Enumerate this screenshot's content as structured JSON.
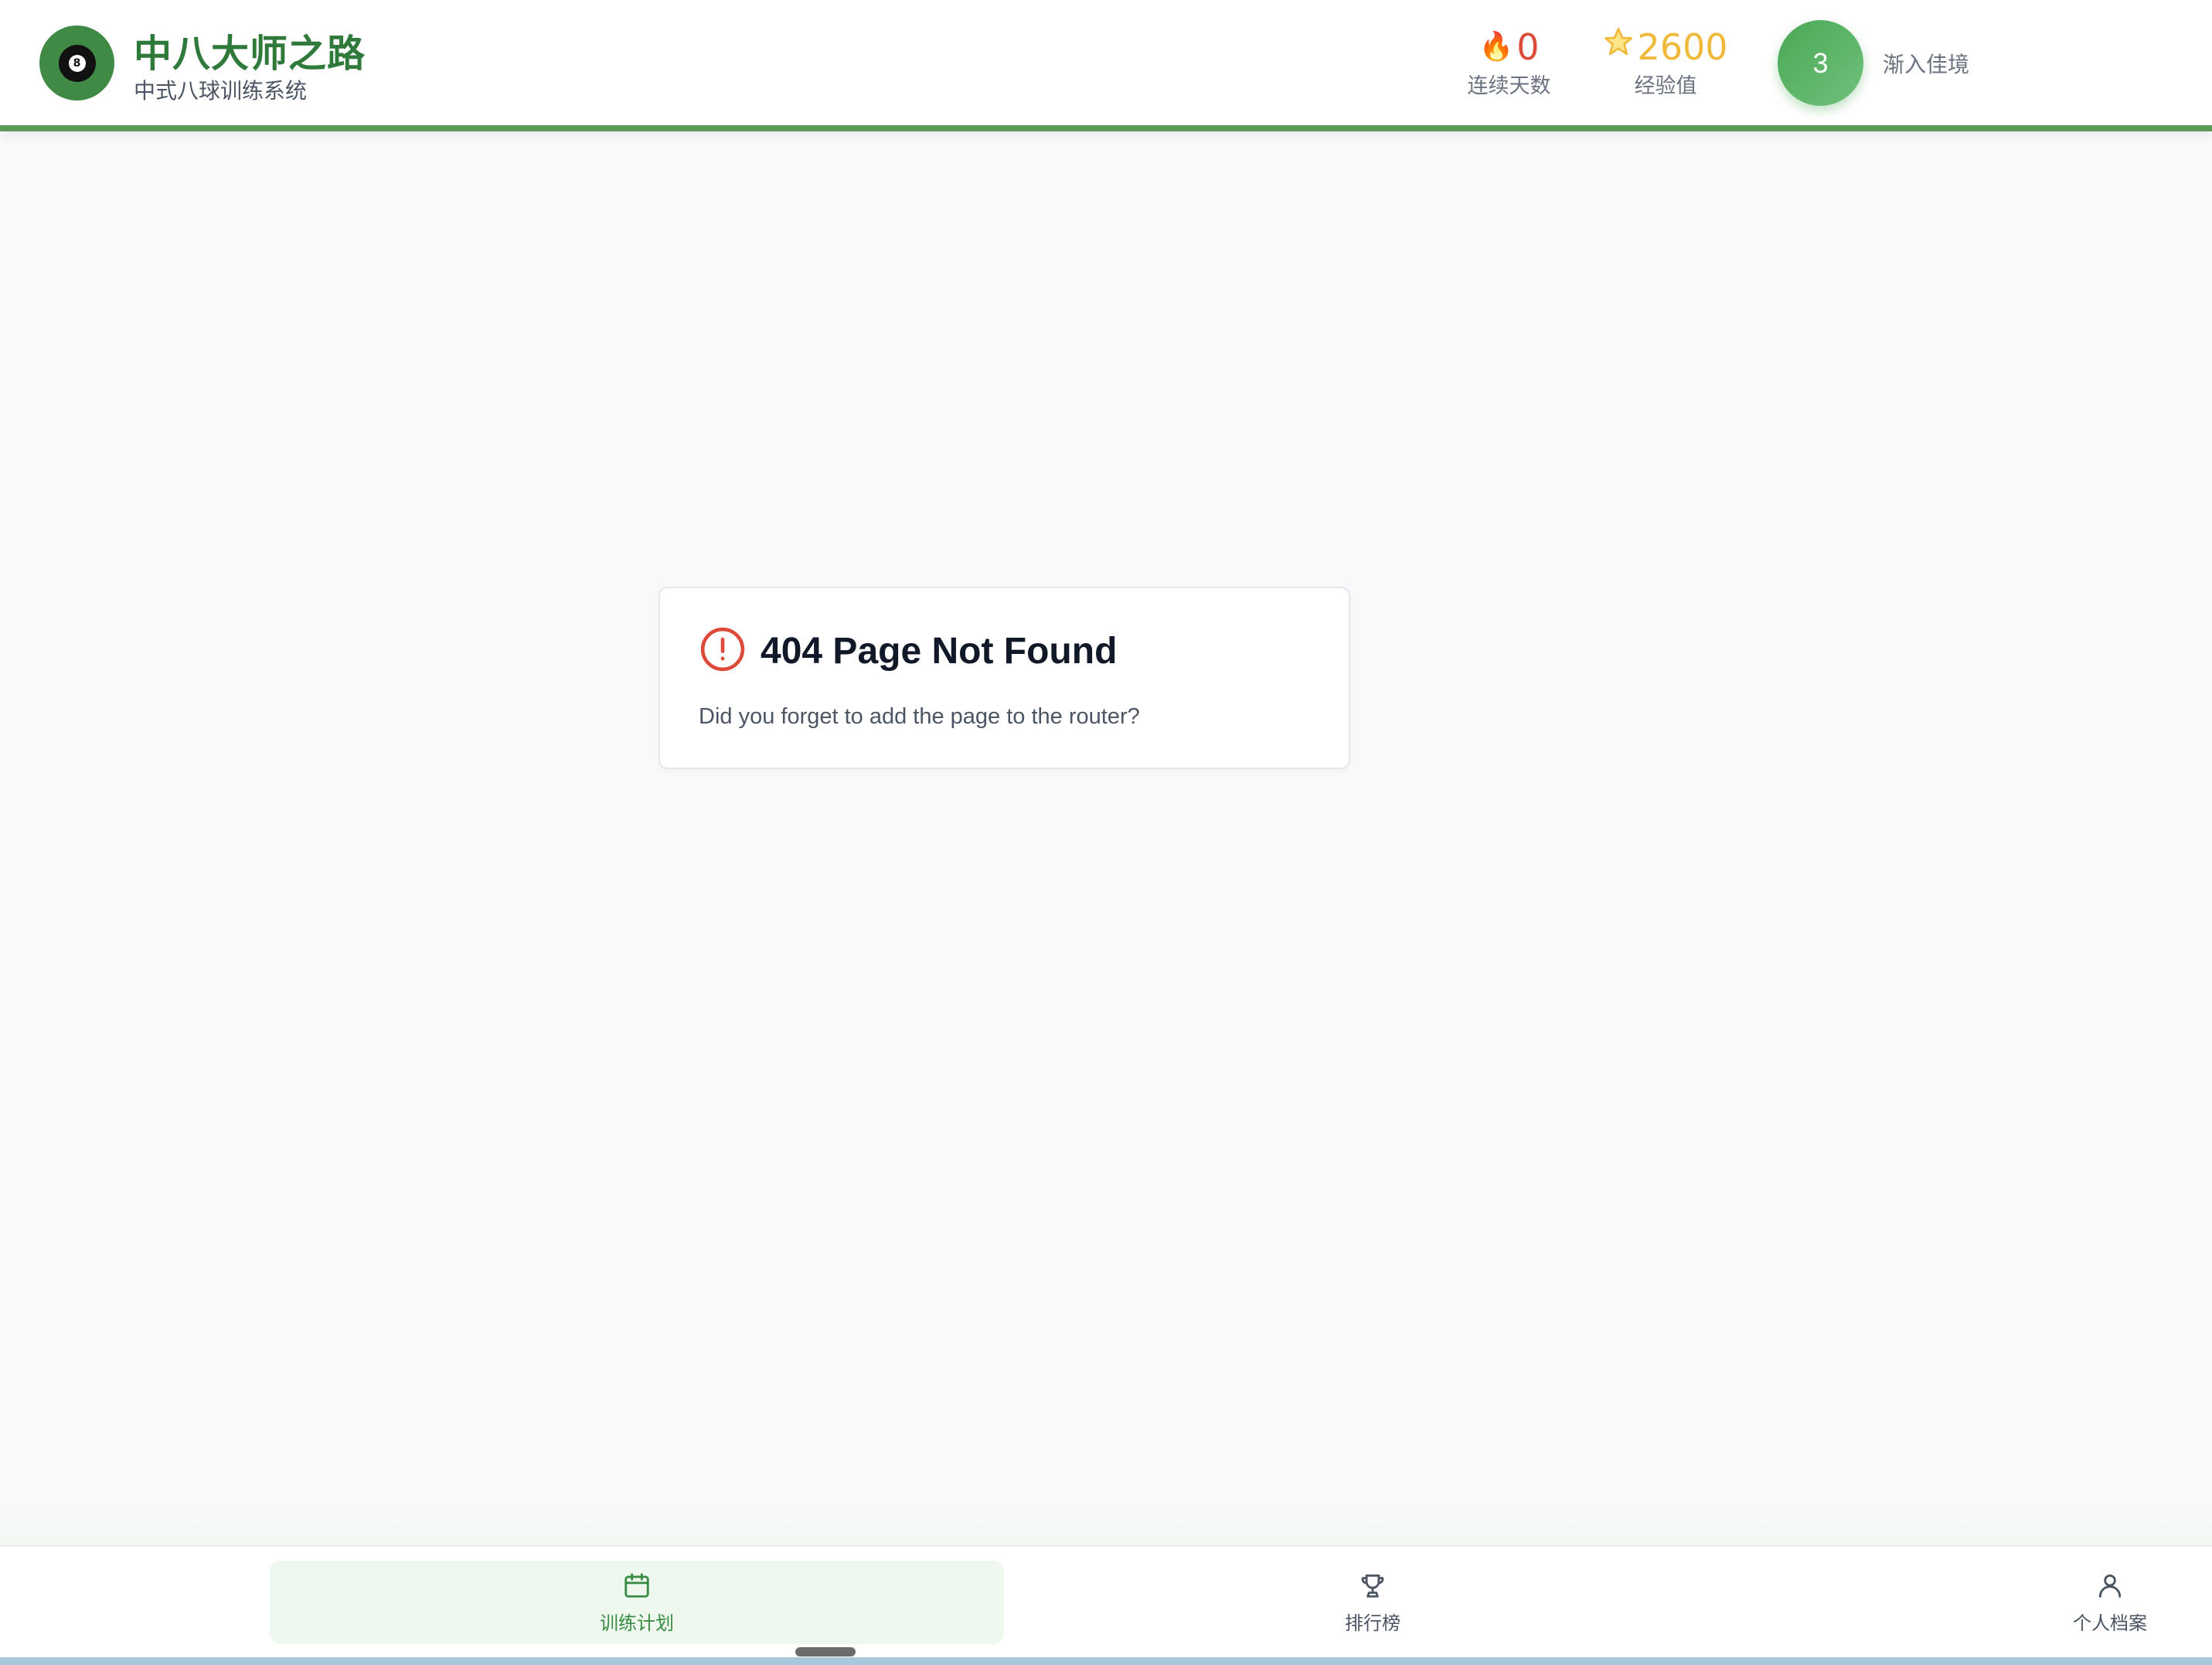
{
  "header": {
    "app_title": "中八大师之路",
    "app_subtitle": "中式八球训练系统",
    "logo_ball_number": "8",
    "streak": {
      "value": "0",
      "label": "连续天数",
      "icon": "flame-icon"
    },
    "xp": {
      "value": "2600",
      "label": "经验值",
      "icon": "star-icon"
    },
    "level": {
      "number": "3",
      "name": "渐入佳境"
    },
    "accent_color": "#5a9a56"
  },
  "main": {
    "error_card": {
      "icon": "alert-circle-icon",
      "title": "404 Page Not Found",
      "description": "Did you forget to add the page to the router?"
    }
  },
  "bottom_nav": {
    "items": [
      {
        "label": "训练计划",
        "icon": "calendar-icon",
        "active": true
      },
      {
        "label": "排行榜",
        "icon": "trophy-icon",
        "active": false
      },
      {
        "label": "个人档案",
        "icon": "user-icon",
        "active": false
      }
    ],
    "active_color": "#3a8c44"
  }
}
